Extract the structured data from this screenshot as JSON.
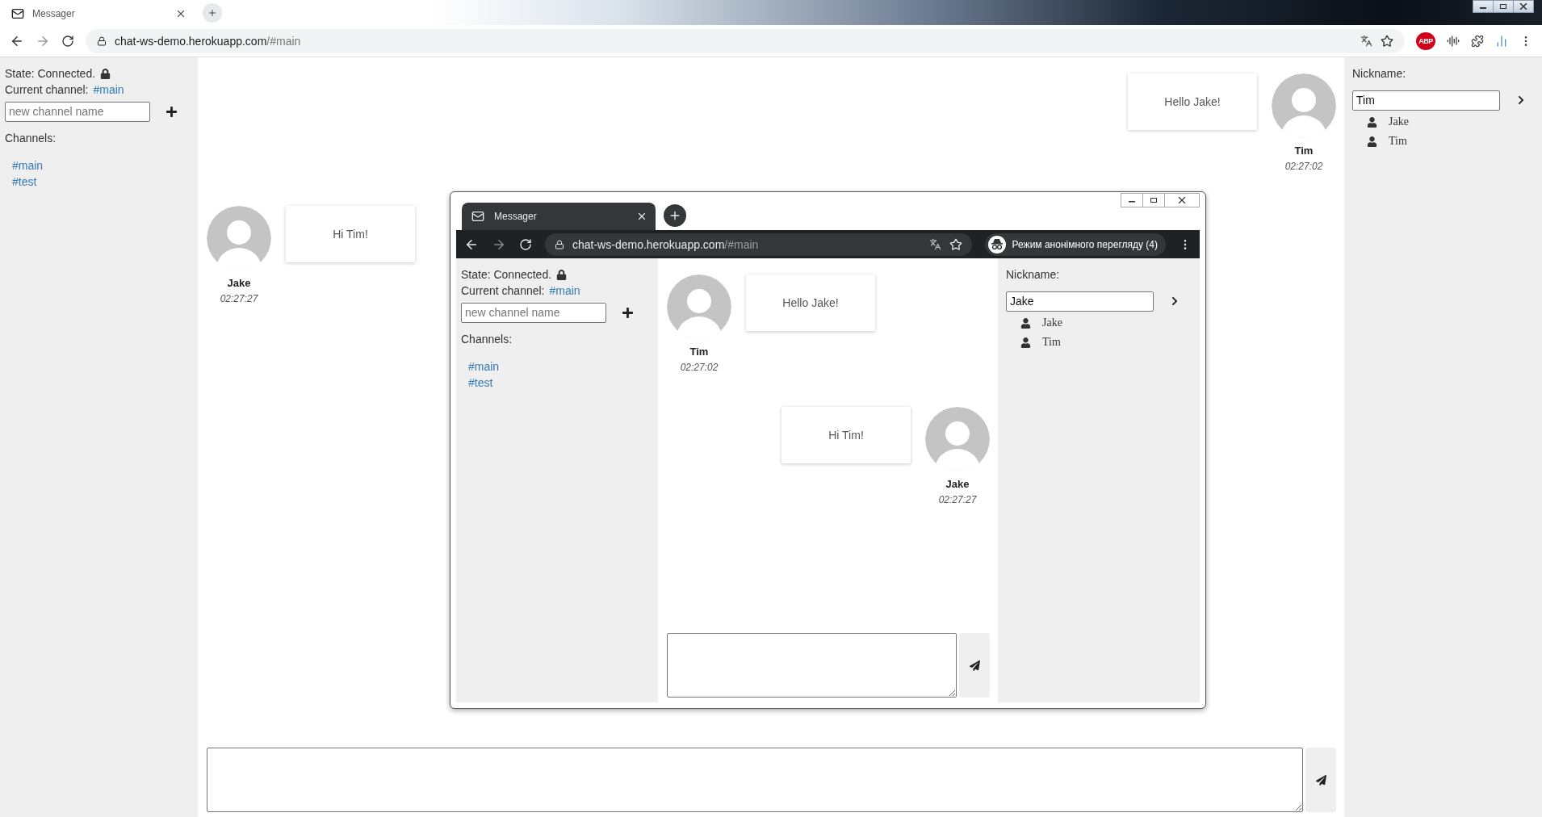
{
  "window": {
    "tab_title": "Messager",
    "url_host": "chat-ws-demo.herokuapp.com",
    "url_path": "/#main",
    "abp_badge": "ABP"
  },
  "page": {
    "state": "State: Connected.",
    "current_channel_label": "Current channel:",
    "current_channel": "#main",
    "new_channel_placeholder": "new channel name",
    "channels_label": "Channels:",
    "channels": [
      "#main",
      "#test"
    ],
    "messages": [
      {
        "kind": "own",
        "author": "Tim",
        "time": "02:27:02",
        "text": "Hello Jake!"
      },
      {
        "kind": "other",
        "author": "Jake",
        "time": "02:27:27",
        "text": "Hi Tim!"
      }
    ],
    "nickname_label": "Nickname:",
    "nickname": "Tim",
    "users": [
      "Jake",
      "Tim"
    ]
  },
  "incognito_window": {
    "tab_title": "Messager",
    "url_host": "chat-ws-demo.herokuapp.com",
    "url_path": "/#main",
    "incognito_label": "Режим анонімного перегляду (4)",
    "page": {
      "state": "State: Connected.",
      "current_channel_label": "Current channel:",
      "current_channel": "#main",
      "new_channel_placeholder": "new channel name",
      "channels_label": "Channels:",
      "channels": [
        "#main",
        "#test"
      ],
      "messages": [
        {
          "kind": "other",
          "author": "Tim",
          "time": "02:27:02",
          "text": "Hello Jake!"
        },
        {
          "kind": "own",
          "author": "Jake",
          "time": "02:27:27",
          "text": "Hi Tim!"
        }
      ],
      "nickname_label": "Nickname:",
      "nickname": "Jake",
      "users": [
        "Jake",
        "Tim"
      ]
    }
  }
}
